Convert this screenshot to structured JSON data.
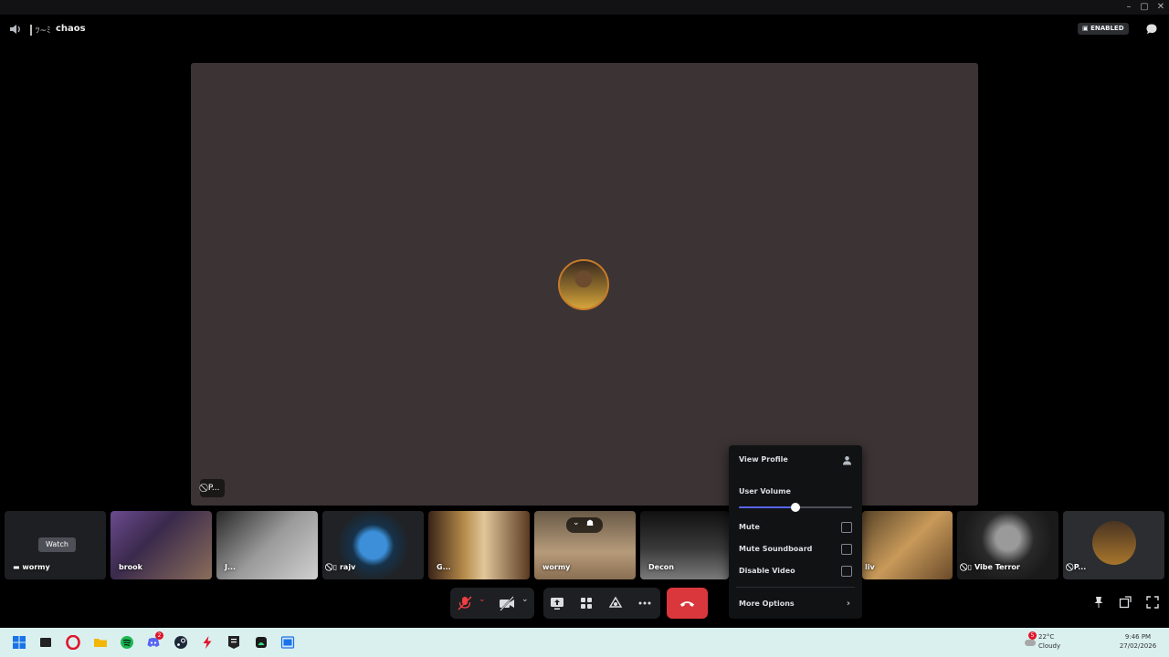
{
  "header": {
    "channel_decoration": "ﾂ~ﾐ",
    "channel_name": "chaos",
    "badge_label": "ENABLED"
  },
  "stage": {
    "participant_tag": "P..."
  },
  "tiles": [
    {
      "label": "wormy",
      "watch_label": "Watch"
    },
    {
      "label": "brook"
    },
    {
      "label": "J..."
    },
    {
      "label": "rajv"
    },
    {
      "label": "G..."
    },
    {
      "label": "wormy"
    },
    {
      "label": "Decon"
    },
    {
      "label": "liv"
    },
    {
      "label": "Vibe Terror"
    },
    {
      "label": "P..."
    }
  ],
  "context_menu": {
    "view_profile": "View Profile",
    "user_volume": "User Volume",
    "volume_level": 0.5,
    "mute": "Mute",
    "mute_soundboard": "Mute Soundboard",
    "disable_video": "Disable Video",
    "more_options": "More Options"
  },
  "taskbar": {
    "weather_badge": "5",
    "temperature": "22°C",
    "weather": "Cloudy",
    "time": "9:46 PM",
    "date": "27/02/2026",
    "discord_badge": "2"
  },
  "colors": {
    "stage_bg": "#3b3334",
    "hangup": "#da373c",
    "accent": "#5865f2",
    "taskbar_bg": "#d9f0ef"
  }
}
